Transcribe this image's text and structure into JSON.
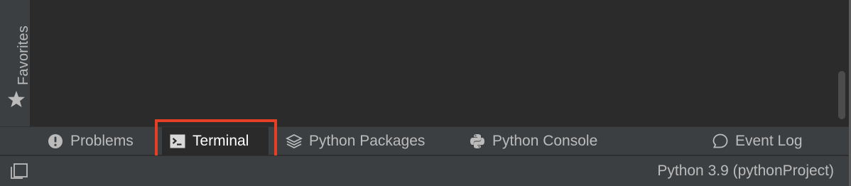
{
  "sidebar": {
    "favorites_label": "Favorites"
  },
  "tool_window_bar": {
    "tabs": [
      {
        "label": "Problems",
        "icon": "problems-icon"
      },
      {
        "label": "Terminal",
        "icon": "terminal-icon",
        "active": true
      },
      {
        "label": "Python Packages",
        "icon": "layers-icon"
      },
      {
        "label": "Python Console",
        "icon": "python-icon"
      },
      {
        "label": "Event Log",
        "icon": "speech-bubble-icon"
      }
    ]
  },
  "status_bar": {
    "interpreter": "Python 3.9 (pythonProject)"
  },
  "colors": {
    "highlight": "#e53f26",
    "panel": "#3c3f41",
    "editor": "#2b2b2b"
  }
}
